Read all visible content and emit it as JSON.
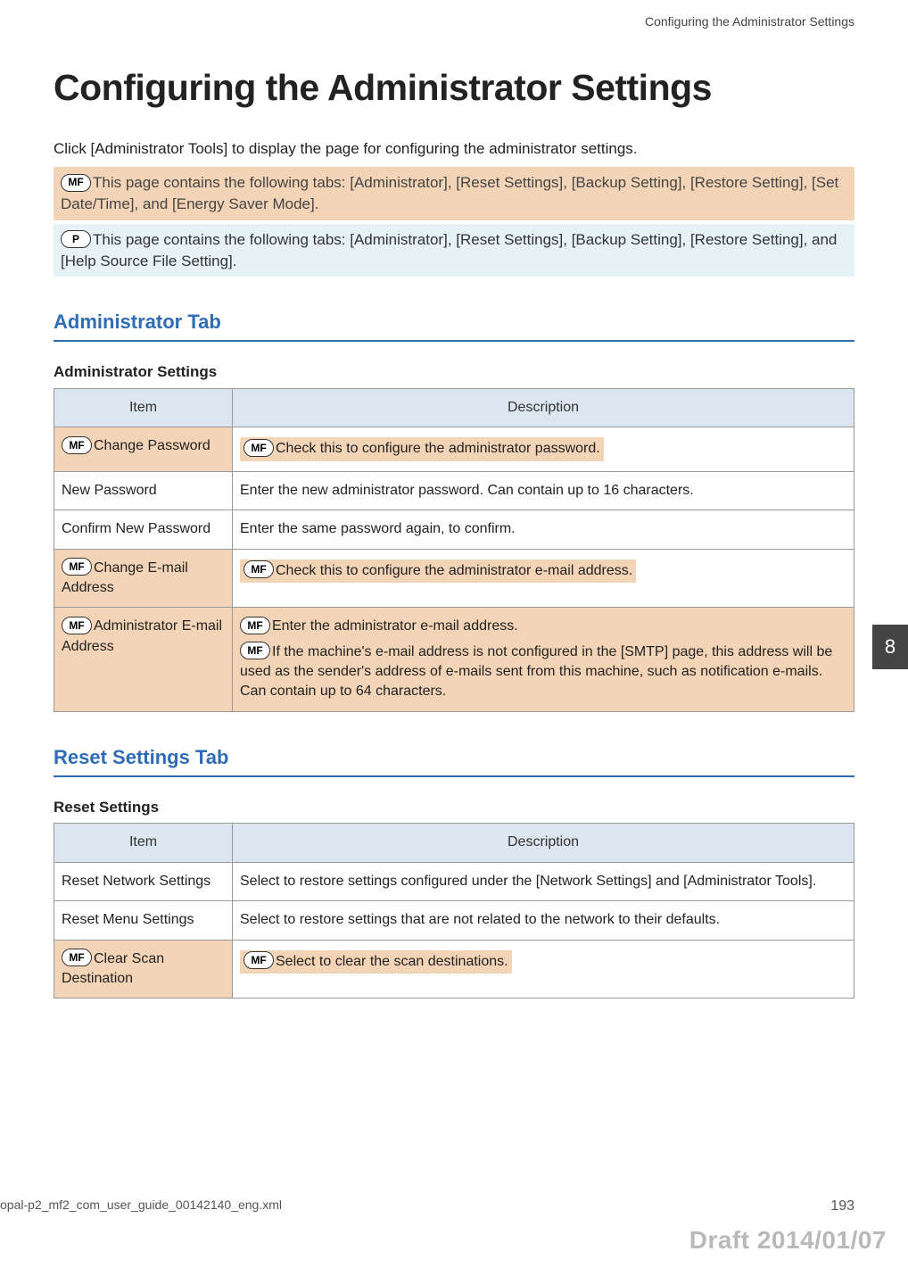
{
  "header": {
    "running_title": "Configuring the Administrator Settings"
  },
  "title": "Configuring the Administrator Settings",
  "intro": "Click [Administrator Tools] to display the page for configuring the administrator settings.",
  "badges": {
    "mf": "MF",
    "p": "P"
  },
  "callouts": {
    "mf": "This page contains the following tabs: [Administrator], [Reset Settings], [Backup Setting], [Restore Setting], [Set Date/Time], and [Energy Saver Mode].",
    "p": "This page contains the following tabs: [Administrator], [Reset Settings], [Backup Setting], [Restore Setting], and [Help Source File Setting]."
  },
  "sections": {
    "admin": {
      "heading": "Administrator Tab",
      "sub": "Administrator Settings",
      "columns": {
        "item": "Item",
        "desc": "Description"
      },
      "rows": [
        {
          "item_mf": true,
          "item": "Change Password",
          "desc_mf": true,
          "desc": "Check this to configure the administrator password."
        },
        {
          "item_mf": false,
          "item": "New Password",
          "desc_mf": false,
          "desc": "Enter the new administrator password. Can contain up to 16 characters."
        },
        {
          "item_mf": false,
          "item": "Confirm New Password",
          "desc_mf": false,
          "desc": "Enter the same password again, to confirm."
        },
        {
          "item_mf": true,
          "item": "Change E-mail Address",
          "desc_mf": true,
          "desc": "Check this to configure the administrator e-mail address."
        },
        {
          "item_mf": true,
          "item": "Administrator E-mail Address",
          "desc_mf": true,
          "desc": "Enter the administrator e-mail address.",
          "desc2_mf": true,
          "desc2": "If the machine's e-mail address is not configured in the [SMTP] page, this address will be used as the sender's address of e-mails sent from this machine, such as notification e-mails. Can contain up to 64 characters."
        }
      ]
    },
    "reset": {
      "heading": "Reset Settings Tab",
      "sub": "Reset Settings",
      "columns": {
        "item": "Item",
        "desc": "Description"
      },
      "rows": [
        {
          "item_mf": false,
          "item": "Reset Network Settings",
          "desc_mf": false,
          "desc": "Select to restore settings configured under the [Network Settings] and [Administrator Tools]."
        },
        {
          "item_mf": false,
          "item": "Reset Menu Settings",
          "desc_mf": false,
          "desc": "Select to restore settings that are not related to the network to their defaults."
        },
        {
          "item_mf": true,
          "item": "Clear Scan Destination",
          "desc_mf": true,
          "desc": "Select to clear the scan destinations."
        }
      ]
    }
  },
  "side_tab": "8",
  "footer": {
    "left": "opal-p2_mf2_com_user_guide_00142140_eng.xml",
    "right": "193"
  },
  "draft": "Draft 2014/01/07"
}
